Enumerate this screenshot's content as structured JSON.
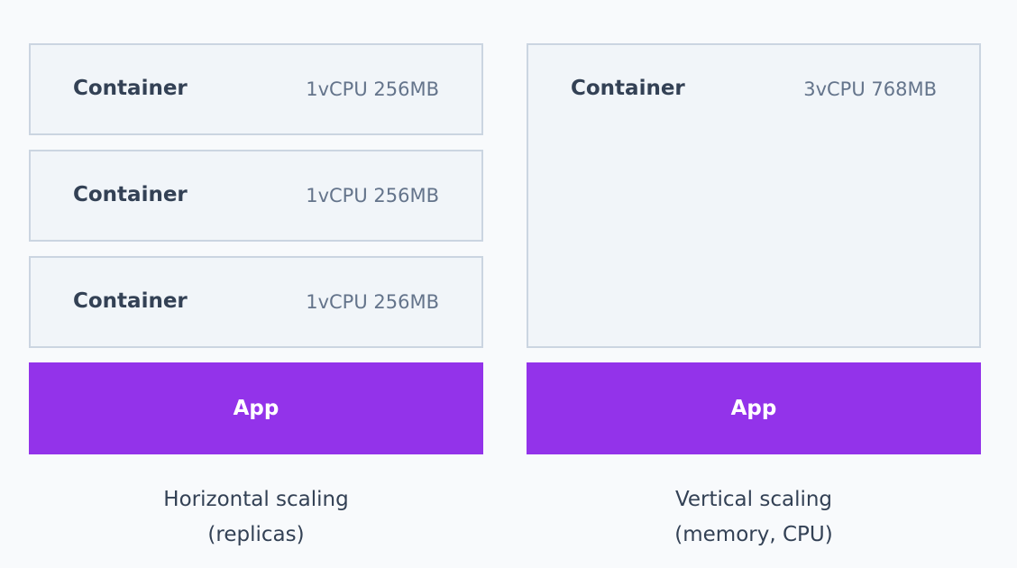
{
  "horizontal": {
    "containers": [
      {
        "label": "Container",
        "spec": "1vCPU 256MB"
      },
      {
        "label": "Container",
        "spec": "1vCPU 256MB"
      },
      {
        "label": "Container",
        "spec": "1vCPU 256MB"
      }
    ],
    "app": "App",
    "caption_line1": "Horizontal scaling",
    "caption_line2": "(replicas)"
  },
  "vertical": {
    "container": {
      "label": "Container",
      "spec": "3vCPU 768MB"
    },
    "app": "App",
    "caption_line1": "Vertical scaling",
    "caption_line2": "(memory, CPU)"
  },
  "colors": {
    "app": "#9333ea",
    "box_bg": "#f1f5f9",
    "box_border": "#cbd5e1",
    "text": "#334155"
  }
}
